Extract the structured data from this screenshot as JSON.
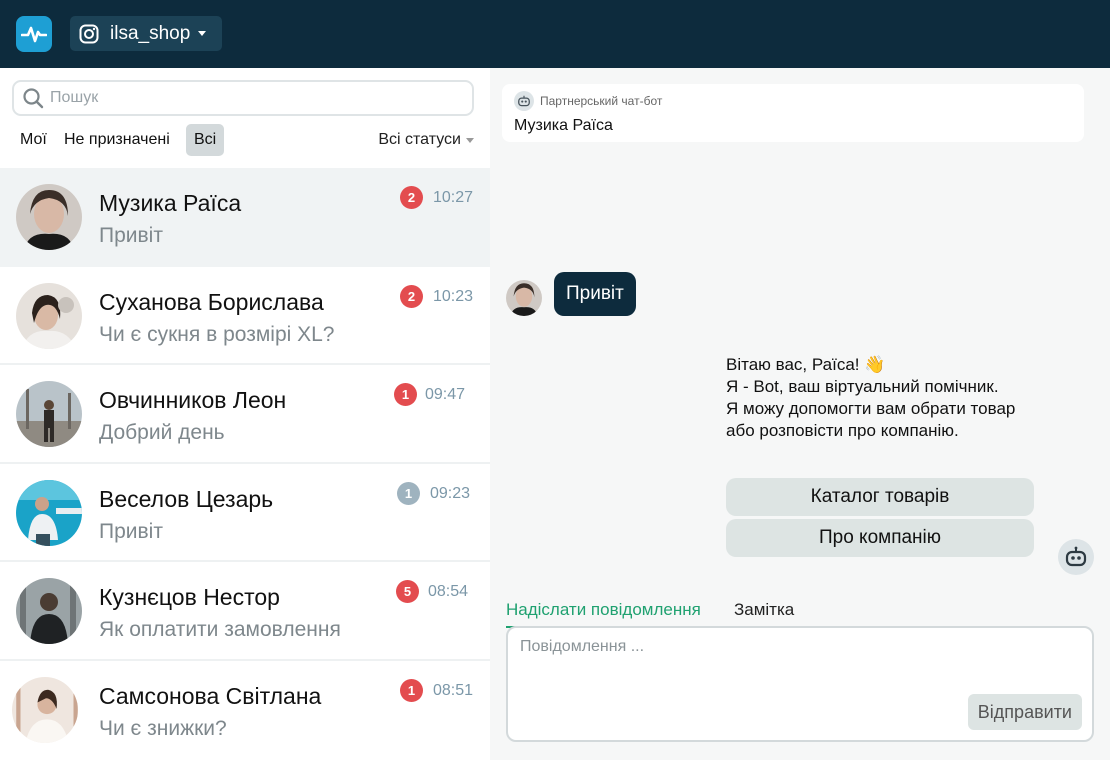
{
  "header": {
    "account_name": "ilsa_shop"
  },
  "sidebar": {
    "search": {
      "placeholder": "Пошук",
      "value": ""
    },
    "filters": [
      {
        "label": "Мої",
        "active": false
      },
      {
        "label": "Не призначені",
        "active": false
      },
      {
        "label": "Всі",
        "active": true
      }
    ],
    "status_filter": "Всі статуси",
    "conversations": [
      {
        "name": "Музика Раїса",
        "preview": "Привіт",
        "unread": "2",
        "time": "10:27",
        "selected": true
      },
      {
        "name": "Суханова Борислава",
        "preview": "Чи є сукня в розмірі XL?",
        "unread": "2",
        "time": "10:23",
        "selected": false
      },
      {
        "name": "Овчинников Леон",
        "preview": "Добрий день",
        "unread": "1",
        "time": "09:47",
        "selected": false
      },
      {
        "name": "Веселов Цезарь",
        "preview": "Привіт",
        "unread": "1",
        "time": "09:23",
        "selected": false
      },
      {
        "name": "Кузнєцов Нестор",
        "preview": "Як оплатити замовлення",
        "unread": "5",
        "time": "08:54",
        "selected": false
      },
      {
        "name": "Самсонова Світлана",
        "preview": "Чи є знижки?",
        "unread": "1",
        "time": "08:51",
        "selected": false
      }
    ]
  },
  "chat": {
    "bot_card": {
      "label": "Партнерський чат-бот",
      "name": "Музика Раїса"
    },
    "incoming_message": "Привіт",
    "bot_message": "Вітаю вас, Раїса! 👋\nЯ - Bot, ваш віртуальний помічник.\nЯ можу допомогти вам обрати товар  або розповісти про компанію.",
    "quick_replies": [
      "Каталог товарів",
      "Про компанію"
    ],
    "tabs": [
      {
        "label": "Надіслати повідомлення",
        "active": true
      },
      {
        "label": "Замітка",
        "active": false
      }
    ],
    "composer": {
      "placeholder": "Повідомлення ...",
      "value": ""
    },
    "send_label": "Відправити"
  },
  "colors": {
    "topbar": "#0d2b3d",
    "accent_green": "#1fa170",
    "badge_red": "#e34c4f",
    "badge_grey": "#9fb3bf"
  }
}
